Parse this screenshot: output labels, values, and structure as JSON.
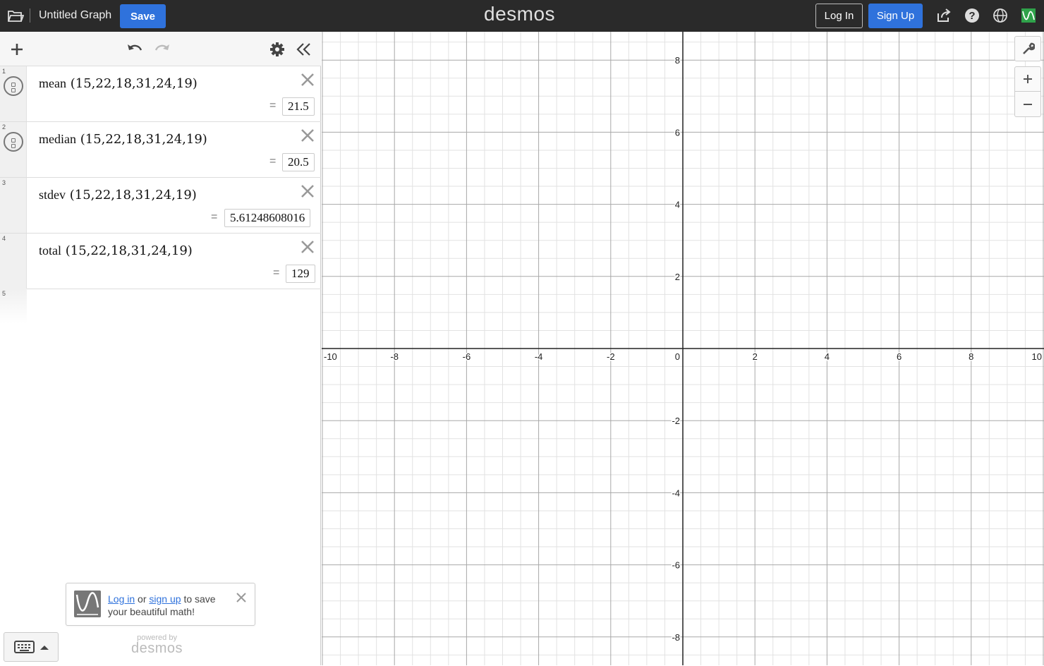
{
  "header": {
    "title": "Untitled Graph",
    "save_label": "Save",
    "logo": "desmos",
    "login_label": "Log In",
    "signup_label": "Sign Up",
    "icons": [
      "folder-icon",
      "share-icon",
      "help-icon",
      "globe-icon",
      "account-icon"
    ]
  },
  "expressions": [
    {
      "num": "1",
      "func": "mean",
      "args": "(15,22,18,31,24,19)",
      "result": "21.5",
      "has_toggle": true
    },
    {
      "num": "2",
      "func": "median",
      "args": "(15,22,18,31,24,19)",
      "result": "20.5",
      "has_toggle": true
    },
    {
      "num": "3",
      "func": "stdev",
      "args": "(15,22,18,31,24,19)",
      "result": "5.61248608016",
      "has_toggle": false
    },
    {
      "num": "4",
      "func": "total",
      "args": "(15,22,18,31,24,19)",
      "result": "129",
      "has_toggle": false
    }
  ],
  "empty_row_num": "5",
  "toast": {
    "login_link": "Log in",
    "or": "or",
    "signup_link": "sign up",
    "rest": "to save your beautiful math!"
  },
  "powered": {
    "line1": "powered by",
    "line2": "desmos"
  },
  "graph": {
    "x_range": [
      -10,
      10
    ],
    "y_range": [
      -8.7,
      8.7
    ],
    "x_ticks": [
      "-10",
      "-8",
      "-6",
      "-4",
      "-2",
      "2",
      "4",
      "6",
      "8",
      "10"
    ],
    "y_ticks": [
      "8",
      "6",
      "4",
      "2",
      "-2",
      "-4",
      "-6",
      "-8"
    ],
    "origin_label": "0"
  },
  "colors": {
    "accent": "#2f72dc",
    "header": "#2a2a2a",
    "account": "#2fa24a"
  }
}
